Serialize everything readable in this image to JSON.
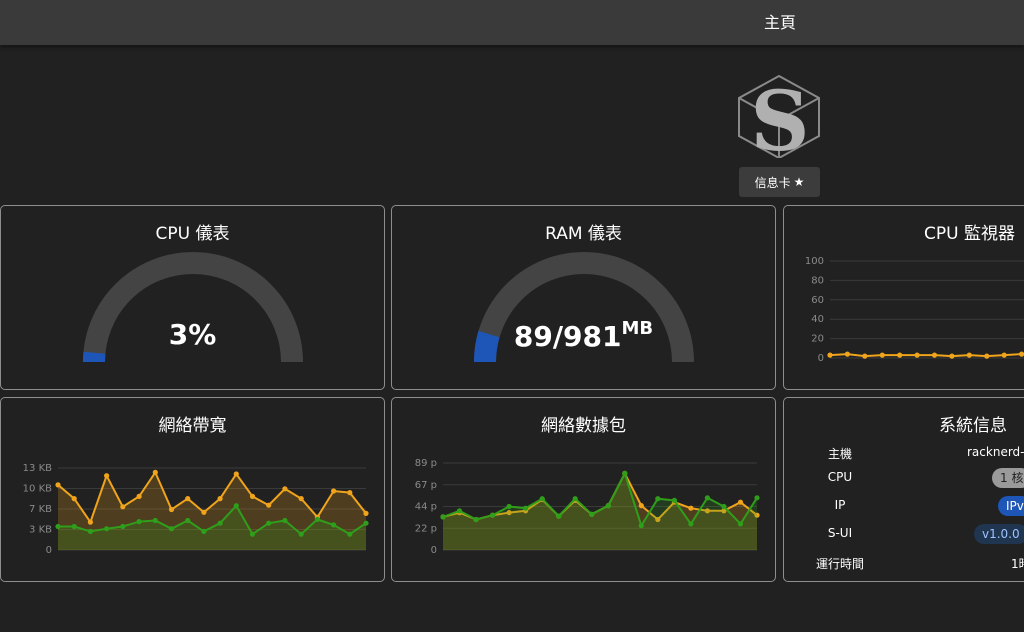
{
  "header": {
    "title": "主頁"
  },
  "logo": {
    "letter": "S",
    "name": "s-ui-logo"
  },
  "info_button": {
    "label": "信息卡",
    "icon": "star-add-icon"
  },
  "cpu_gauge": {
    "title": "CPU 儀表",
    "value_text": "3%",
    "percent": 3
  },
  "ram_gauge": {
    "title": "RAM 儀表",
    "used": "89",
    "total": "981",
    "unit": "MB",
    "percent": 9.1
  },
  "cpu_monitor": {
    "title": "CPU 監視器"
  },
  "bandwidth": {
    "title": "網絡帶寬"
  },
  "packets": {
    "title": "網絡數據包"
  },
  "sysinfo": {
    "title": "系統信息",
    "host_label": "主機",
    "host_value": "racknerd-",
    "cpu_label": "CPU",
    "cpu_value": "1 核",
    "ip_label": "IP",
    "ip_value": "IPv",
    "sui_label": "S-UI",
    "sui_value": "v1.0.0",
    "uptime_label": "運行時間",
    "uptime_value": "1時"
  },
  "colors": {
    "accent_orange": "#f0a41c",
    "accent_green": "#2f9e1a",
    "gauge_blue": "#1e56b8",
    "gauge_track": "#444444",
    "card_border": "#8e8e8e"
  },
  "chart_data": [
    {
      "type": "line",
      "title": "CPU 監視器",
      "y_ticks": [
        "0",
        "20",
        "40",
        "60",
        "80",
        "100"
      ],
      "ylim": [
        0,
        100
      ],
      "series": [
        {
          "values": [
            3,
            4,
            2,
            3,
            3,
            3,
            3,
            2,
            3,
            2,
            3,
            4,
            3
          ]
        }
      ]
    },
    {
      "type": "area",
      "title": "網絡帶寬",
      "y_ticks": [
        "0",
        "3 KB",
        "7 KB",
        "10 KB",
        "13 KB"
      ],
      "ylim": [
        0,
        15
      ],
      "series": [
        {
          "values": [
            11.9,
            9.4,
            5.1,
            13.6,
            7.9,
            9.8,
            14.2,
            7.4,
            9.4,
            6.9,
            9.4,
            13.9,
            9.8,
            8.2,
            11.2,
            9.4,
            6.0,
            10.8,
            10.5,
            6.7
          ]
        },
        {
          "values": [
            4.3,
            4.3,
            3.4,
            3.9,
            4.3,
            5.2,
            5.4,
            3.9,
            5.4,
            3.4,
            4.9,
            8.1,
            2.9,
            4.9,
            5.4,
            2.9,
            5.6,
            4.6,
            2.9,
            4.9
          ]
        }
      ]
    },
    {
      "type": "area",
      "title": "網絡數據包",
      "y_ticks": [
        "0",
        "22 p",
        "44 p",
        "67 p",
        "89 p"
      ],
      "ylim": [
        0,
        100
      ],
      "series": [
        {
          "values": [
            38,
            43,
            35,
            40,
            43,
            45,
            58,
            39,
            57,
            41,
            51,
            88,
            51,
            35,
            55,
            48,
            45,
            45,
            55,
            40
          ]
        },
        {
          "values": [
            38,
            45,
            35,
            40,
            50,
            48,
            59,
            39,
            59,
            41,
            51,
            88,
            28,
            59,
            57,
            30,
            60,
            50,
            30,
            60
          ]
        }
      ]
    }
  ]
}
